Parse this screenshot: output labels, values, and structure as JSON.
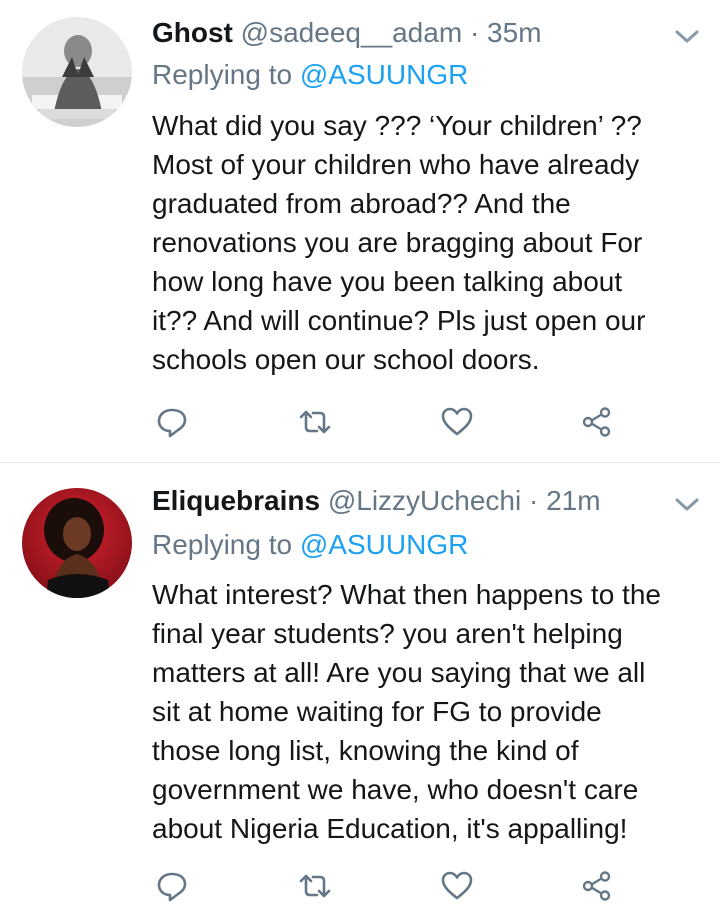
{
  "tweets": [
    {
      "display_name": "Ghost",
      "handle": "@sadeeq__adam",
      "separator": "·",
      "time": "35m",
      "replying_label": "Replying to",
      "replying_handle": "@ASUUNGR",
      "lines": [
        "What did you say ??? ‘Your children’ ??",
        "Most of your children who have already",
        "graduated from abroad?? And the",
        "renovations you are bragging about For",
        "how long have you been talking about",
        "it?? And will continue? Pls just open our",
        "schools open our school doors."
      ],
      "avatar_icon": "avatar-photo-grayscale"
    },
    {
      "display_name": "Eliquebrains",
      "handle": "@LizzyUchechi",
      "separator": "·",
      "time": "21m",
      "replying_label": "Replying to",
      "replying_handle": "@ASUUNGR",
      "lines": [
        "What interest? What then happens to the",
        "final year students? you aren't helping",
        "matters at all! Are you saying that we all",
        "sit at home waiting for FG to provide",
        "those long list, knowing the kind of",
        "government we have, who doesn't care",
        "about Nigeria Education, it's appalling!"
      ],
      "avatar_icon": "avatar-photo-red"
    }
  ],
  "actions": {
    "icons": [
      "reply-icon",
      "retweet-icon",
      "like-icon",
      "share-icon"
    ]
  },
  "colors": {
    "name": "#14171a",
    "meta": "#657786",
    "link": "#1da1f2",
    "divider": "#e1e8ed"
  }
}
